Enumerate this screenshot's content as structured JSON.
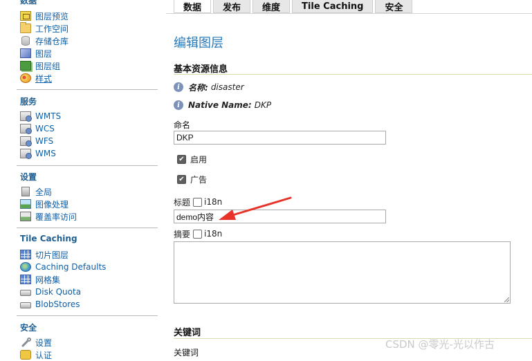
{
  "sidebar": {
    "data_section": {
      "title": "数据",
      "items": [
        {
          "label": "图层预览",
          "icon": "layer-preview-icon"
        },
        {
          "label": "工作空间",
          "icon": "folder-icon"
        },
        {
          "label": "存储仓库",
          "icon": "database-icon"
        },
        {
          "label": "图层",
          "icon": "layer-icon"
        },
        {
          "label": "图层组",
          "icon": "layer-group-icon"
        },
        {
          "label": "样式",
          "icon": "style-icon"
        }
      ]
    },
    "services_section": {
      "title": "服务",
      "items": [
        {
          "label": "WMTS",
          "icon": "service-icon"
        },
        {
          "label": "WCS",
          "icon": "service-icon"
        },
        {
          "label": "WFS",
          "icon": "service-icon"
        },
        {
          "label": "WMS",
          "icon": "service-icon"
        }
      ]
    },
    "settings_section": {
      "title": "设置",
      "items": [
        {
          "label": "全局",
          "icon": "server-icon"
        },
        {
          "label": "图像处理",
          "icon": "image-icon"
        },
        {
          "label": "覆盖率访问",
          "icon": "coverage-icon"
        }
      ]
    },
    "tile_caching_section": {
      "title": "Tile Caching",
      "items": [
        {
          "label": "切片图层",
          "icon": "grid-icon"
        },
        {
          "label": "Caching Defaults",
          "icon": "globe-icon"
        },
        {
          "label": "网格集",
          "icon": "grid-icon"
        },
        {
          "label": "Disk Quota",
          "icon": "disk-icon"
        },
        {
          "label": "BlobStores",
          "icon": "disk-icon"
        }
      ]
    },
    "security_section": {
      "title": "安全",
      "items": [
        {
          "label": "设置",
          "icon": "wrench-icon"
        },
        {
          "label": "认证",
          "icon": "key-icon"
        }
      ]
    }
  },
  "tabs": [
    {
      "label": "数据",
      "active": true
    },
    {
      "label": "发布",
      "active": false
    },
    {
      "label": "维度",
      "active": false
    },
    {
      "label": "Tile Caching",
      "active": false
    },
    {
      "label": "安全",
      "active": false
    }
  ],
  "main": {
    "page_title": "编辑图层",
    "basic_info_heading": "基本资源信息",
    "name_info": {
      "key": "名称:",
      "value": "disaster"
    },
    "native_name_info": {
      "key": "Native Name:",
      "value": "DKP"
    },
    "name_label": "命名",
    "name_value": "DKP",
    "enabled_label": "启用",
    "enabled_checked": true,
    "advertised_label": "广告",
    "advertised_checked": true,
    "title_label": "标题",
    "title_i18n_label": "i18n",
    "title_value": "demo内容",
    "abstract_label": "摘要",
    "abstract_i18n_label": "i18n",
    "abstract_value": "",
    "keywords_heading": "关键词",
    "keywords_label": "关键词"
  },
  "watermark": "CSDN @零光-光以作古",
  "colors": {
    "link": "#0b5fa8",
    "section_title": "#1f5f92",
    "page_title": "#2b79b6",
    "annotation_arrow": "#e8332b"
  }
}
